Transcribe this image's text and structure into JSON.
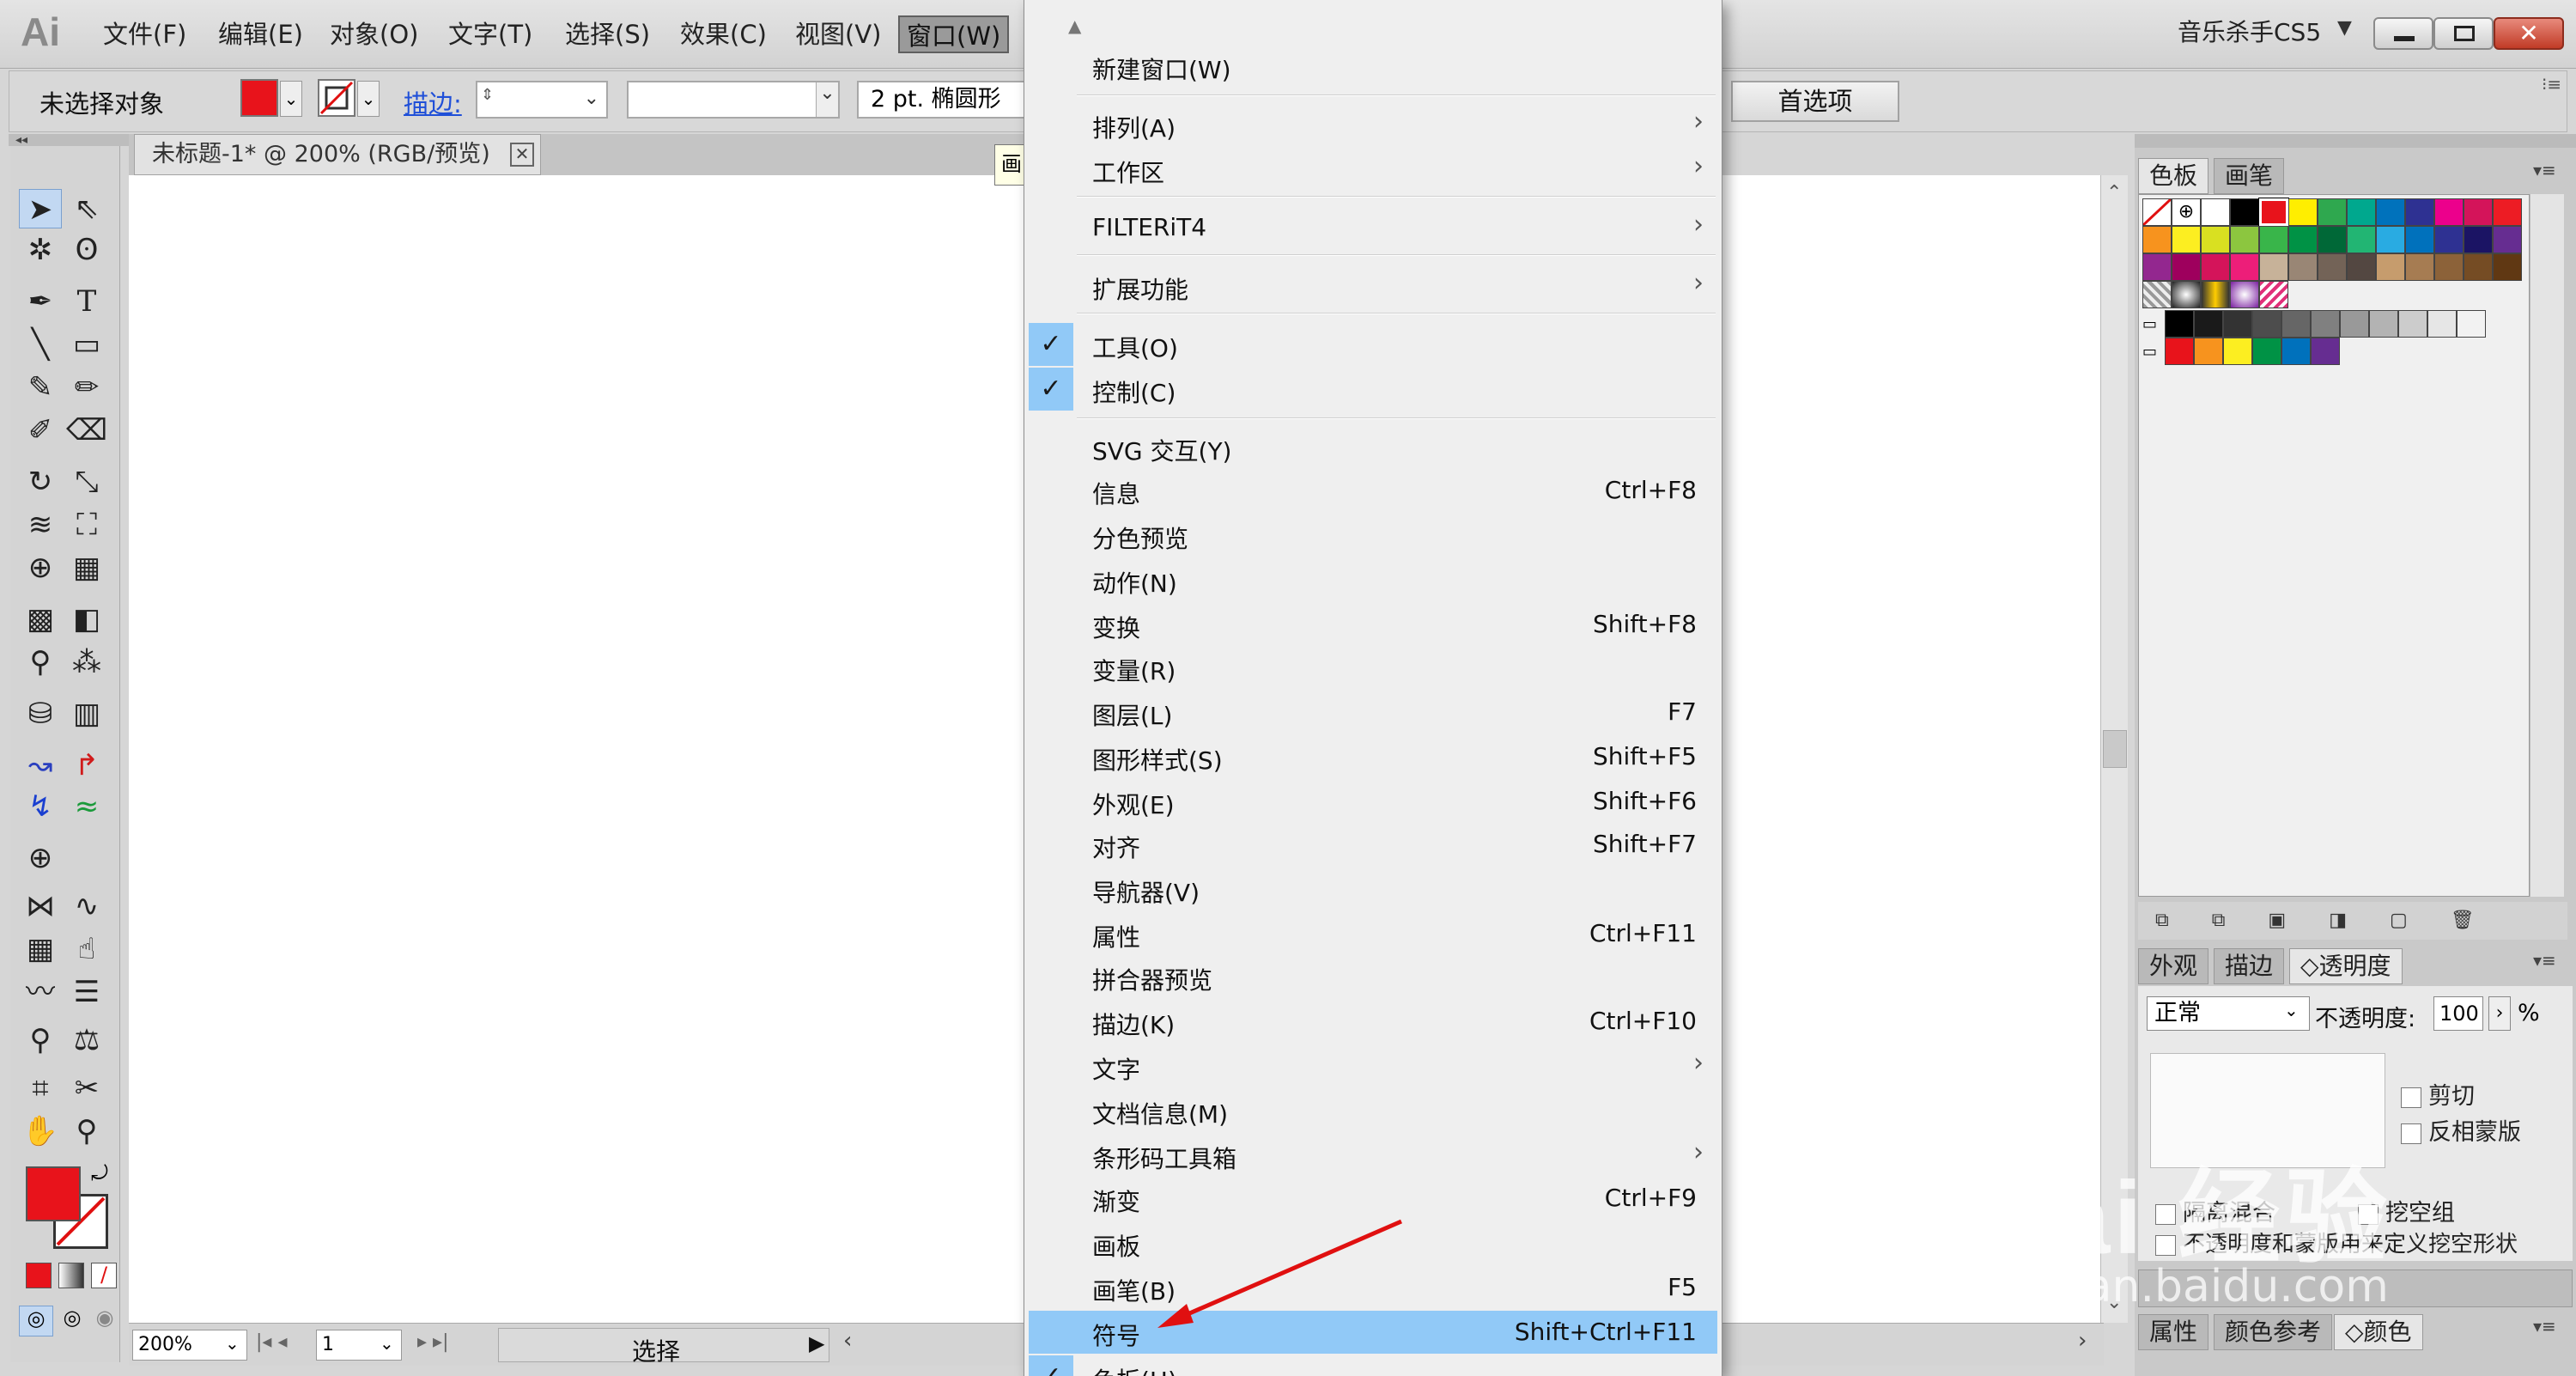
{
  "menubar": {
    "logo": "Ai",
    "items": [
      "文件(F)",
      "编辑(E)",
      "对象(O)",
      "文字(T)",
      "选择(S)",
      "效果(C)",
      "视图(V)",
      "窗口(W)"
    ],
    "profile": "音乐杀手CS5",
    "profile_arrow": "▼"
  },
  "control": {
    "no_selection": "未选择对象",
    "stroke_label": "描边:",
    "brush_value": "2 pt. 椭圆形",
    "preferences": "首选项",
    "fill_color": "#e8131b"
  },
  "document": {
    "tab_title": "未标题-1* @ 200% (RGB/预览)",
    "tooltip_peek": "画"
  },
  "status": {
    "zoom": "200%",
    "page": "1",
    "tool": "选择"
  },
  "panels": {
    "swatches_tab": "色板",
    "brushes_tab": "画笔",
    "appearance_tab": "外观",
    "stroke_tab": "描边",
    "transparency_tab": "◇透明度",
    "blend_mode": "正常",
    "opacity_label": "不透明度:",
    "opacity_value": "100",
    "opacity_unit": "%",
    "clip_label": "剪切",
    "invert_mask_label": "反相蒙版",
    "isolate_blend_label": "隔离混合",
    "knockout_label": "挖空组",
    "opacity_mask_label": "不透明度和蒙版用来定义挖空形状",
    "attributes_tab": "属性",
    "color_guide_tab": "颜色参考",
    "color_tab": "◇颜色"
  },
  "menu": {
    "items": [
      {
        "label": "新建窗口(W)",
        "shortcut": "",
        "submenu": false,
        "checked": false
      },
      {
        "label": "排列(A)",
        "shortcut": "",
        "submenu": true,
        "checked": false
      },
      {
        "label": "工作区",
        "shortcut": "",
        "submenu": true,
        "checked": false
      },
      {
        "label": "FILTERiT4",
        "shortcut": "",
        "submenu": true,
        "checked": false
      },
      {
        "label": "扩展功能",
        "shortcut": "",
        "submenu": true,
        "checked": false
      },
      {
        "label": "工具(O)",
        "shortcut": "",
        "submenu": false,
        "checked": true
      },
      {
        "label": "控制(C)",
        "shortcut": "",
        "submenu": false,
        "checked": true
      },
      {
        "label": "SVG 交互(Y)",
        "shortcut": "",
        "submenu": false,
        "checked": false
      },
      {
        "label": "信息",
        "shortcut": "Ctrl+F8",
        "submenu": false,
        "checked": false
      },
      {
        "label": "分色预览",
        "shortcut": "",
        "submenu": false,
        "checked": false
      },
      {
        "label": "动作(N)",
        "shortcut": "",
        "submenu": false,
        "checked": false
      },
      {
        "label": "变换",
        "shortcut": "Shift+F8",
        "submenu": false,
        "checked": false
      },
      {
        "label": "变量(R)",
        "shortcut": "",
        "submenu": false,
        "checked": false
      },
      {
        "label": "图层(L)",
        "shortcut": "F7",
        "submenu": false,
        "checked": false
      },
      {
        "label": "图形样式(S)",
        "shortcut": "Shift+F5",
        "submenu": false,
        "checked": false
      },
      {
        "label": "外观(E)",
        "shortcut": "Shift+F6",
        "submenu": false,
        "checked": false
      },
      {
        "label": "对齐",
        "shortcut": "Shift+F7",
        "submenu": false,
        "checked": false
      },
      {
        "label": "导航器(V)",
        "shortcut": "",
        "submenu": false,
        "checked": false
      },
      {
        "label": "属性",
        "shortcut": "Ctrl+F11",
        "submenu": false,
        "checked": false
      },
      {
        "label": "拼合器预览",
        "shortcut": "",
        "submenu": false,
        "checked": false
      },
      {
        "label": "描边(K)",
        "shortcut": "Ctrl+F10",
        "submenu": false,
        "checked": false
      },
      {
        "label": "文字",
        "shortcut": "",
        "submenu": true,
        "checked": false
      },
      {
        "label": "文档信息(M)",
        "shortcut": "",
        "submenu": false,
        "checked": false
      },
      {
        "label": "条形码工具箱",
        "shortcut": "",
        "submenu": true,
        "checked": false
      },
      {
        "label": "渐变",
        "shortcut": "Ctrl+F9",
        "submenu": false,
        "checked": false
      },
      {
        "label": "画板",
        "shortcut": "",
        "submenu": false,
        "checked": false
      },
      {
        "label": "画笔(B)",
        "shortcut": "F5",
        "submenu": false,
        "checked": false
      },
      {
        "label": "符号",
        "shortcut": "Shift+Ctrl+F11",
        "submenu": false,
        "checked": false,
        "highlighted": true
      },
      {
        "label": "色板(H)",
        "shortcut": "",
        "submenu": false,
        "checked": true
      }
    ]
  },
  "watermark": {
    "text": "Bai 经验",
    "url": "jingyan.baidu.com"
  },
  "colors": {
    "highlight": "#91c9f7",
    "menu_bg": "#efefef",
    "annotation_arrow": "#e01010"
  }
}
